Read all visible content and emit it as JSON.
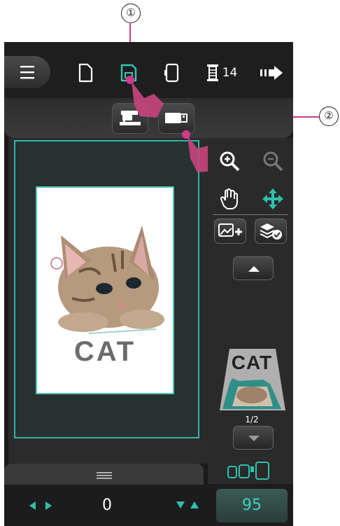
{
  "callouts": {
    "one": "①",
    "two": "②"
  },
  "topbar": {
    "menu_icon": "menu-icon",
    "icons": [
      "new-file-icon",
      "save-icon",
      "hoop-icon",
      "thread-spool-icon",
      "next-arrow-icon"
    ],
    "thread_count": "14"
  },
  "subbar": {
    "buttons": [
      "sewing-machine-icon",
      "usb-stick-icon"
    ]
  },
  "design": {
    "text": "CAT"
  },
  "side": {
    "page_indicator": "1/2"
  },
  "bottom": {
    "position_value": "0",
    "numeric_value": "95"
  },
  "colors": {
    "accent": "#2fb7a6",
    "callout_line": "#d13b8b",
    "value_text": "#3fd3bf"
  }
}
